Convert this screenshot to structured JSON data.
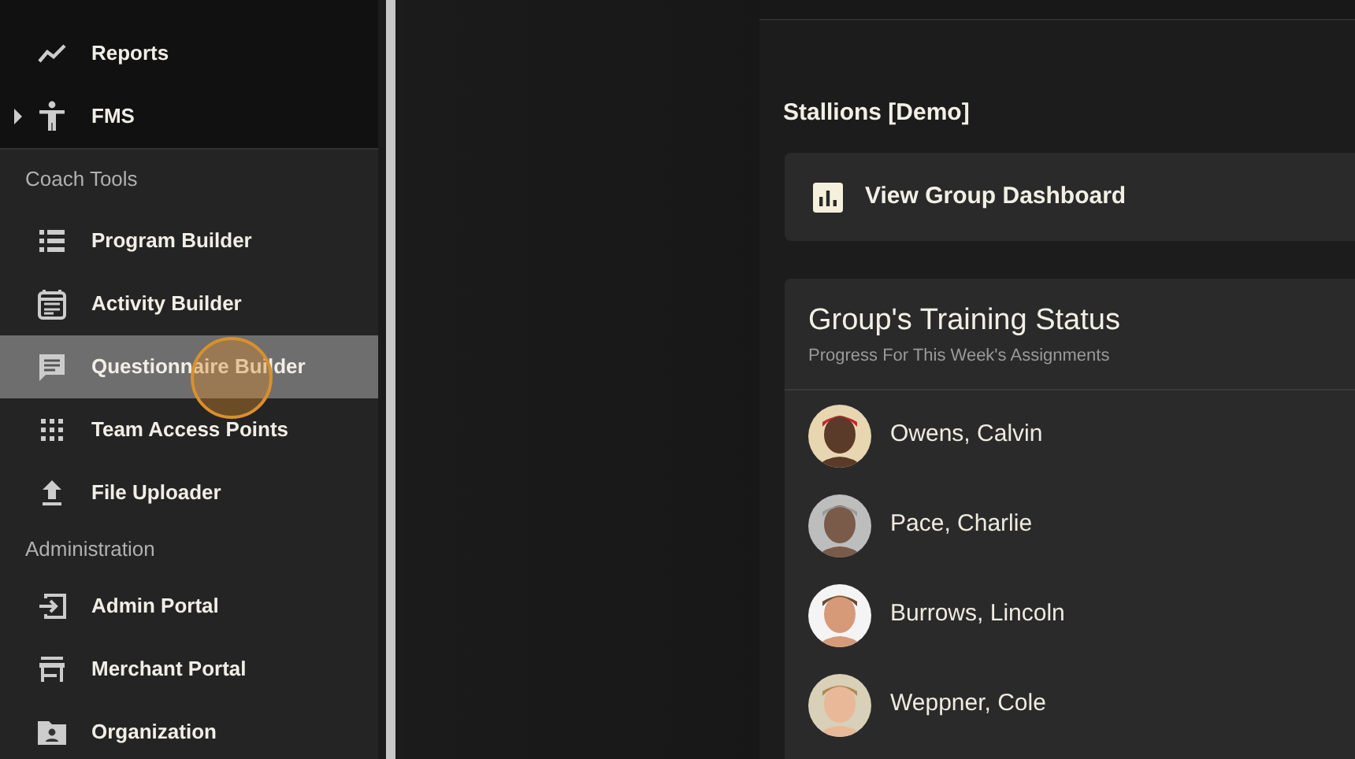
{
  "sidebar": {
    "top_items": [
      {
        "label": "Reports",
        "selected": false
      },
      {
        "label": "FMS",
        "expanded": false,
        "selected": false
      }
    ],
    "sections": [
      {
        "title": "Coach Tools",
        "items": [
          {
            "label": "Program Builder",
            "selected": false
          },
          {
            "label": "Activity Builder",
            "selected": false
          },
          {
            "label": "Questionnaire Builder",
            "selected": true
          },
          {
            "label": "Team Access Points",
            "selected": false
          },
          {
            "label": "File Uploader",
            "selected": false
          }
        ]
      },
      {
        "title": "Administration",
        "items": [
          {
            "label": "Admin Portal",
            "selected": false
          },
          {
            "label": "Merchant Portal",
            "selected": false
          },
          {
            "label": "Organization",
            "selected": false
          }
        ]
      }
    ]
  },
  "group": {
    "title": "Stallions [Demo]",
    "dashboard_button": "View Group Dashboard"
  },
  "training_status": {
    "title": "Group's Training Status",
    "subtitle": "Progress For This Week's Assignments",
    "athletes": [
      {
        "name": "Owens, Calvin",
        "kind": "picture"
      },
      {
        "name": "Pace, Charlie",
        "kind": "picture"
      },
      {
        "name": "Burrows, Lincoln",
        "kind": "picture"
      },
      {
        "name": "Weppner, Cole",
        "kind": "picture"
      }
    ]
  }
}
